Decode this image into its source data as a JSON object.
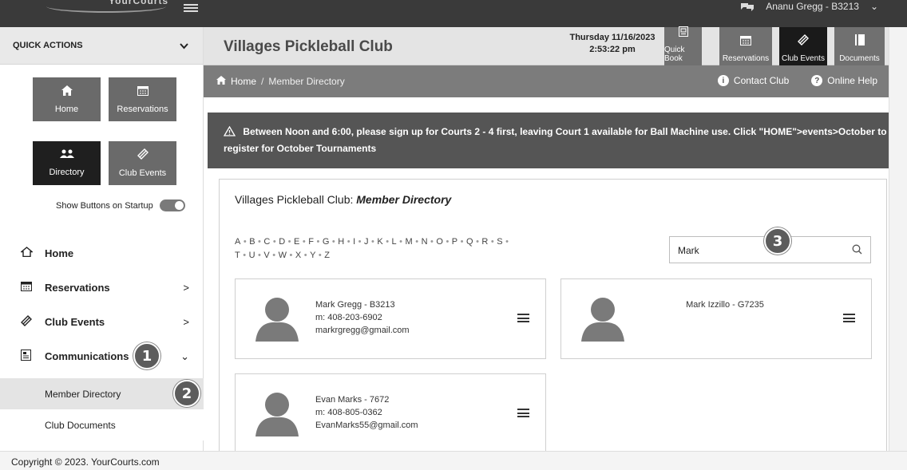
{
  "topbar": {
    "logo_text": "YourCourts",
    "user_name": "Ananu Gregg - B3213",
    "user_chevron": "⌄"
  },
  "sidebar": {
    "quick_actions_title": "QUICK ACTIONS",
    "quick_buttons": [
      {
        "label": "Home",
        "icon": "home-icon"
      },
      {
        "label": "Reservations",
        "icon": "calendar-icon"
      },
      {
        "label": "Directory",
        "icon": "people-icon"
      },
      {
        "label": "Club Events",
        "icon": "ticket-icon"
      }
    ],
    "show_buttons_label": "Show Buttons on Startup",
    "nav": [
      {
        "label": "Home",
        "icon": "home-outline-icon"
      },
      {
        "label": "Reservations",
        "icon": "calendar-icon",
        "arrow": ">"
      },
      {
        "label": "Club Events",
        "icon": "ticket-icon",
        "arrow": ">"
      },
      {
        "label": "Communications",
        "icon": "newspaper-icon",
        "arrow": "⌄"
      }
    ],
    "sub_nav": [
      {
        "label": "Member Directory"
      },
      {
        "label": "Club Documents"
      }
    ]
  },
  "header": {
    "club_name": "Villages Pickleball Club",
    "date": "Thursday 11/16/2023",
    "time": "2:53:22 pm",
    "buttons": [
      {
        "label": "Quick Book",
        "icon": "quickbook-icon"
      },
      {
        "label": "Reservations",
        "icon": "calendar-icon"
      },
      {
        "label": "Club Events",
        "icon": "ticket-icon"
      },
      {
        "label": "Documents",
        "icon": "document-icon"
      }
    ]
  },
  "breadcrumb": {
    "home": "Home",
    "separator": "/",
    "current": "Member Directory",
    "contact": "Contact Club",
    "help": "Online Help"
  },
  "alert": {
    "text": "Between Noon and 6:00, please sign up for Courts 2 - 4 first, leaving Court 1 available for Ball Machine use. Click \"HOME\">events>October to register for October Tournaments"
  },
  "directory": {
    "title_prefix": "Villages Pickleball Club: ",
    "title_emph": "Member Directory",
    "letters_row1": [
      "A",
      "B",
      "C",
      "D",
      "E",
      "F",
      "G",
      "H",
      "I",
      "J",
      "K",
      "L",
      "M",
      "N",
      "O",
      "P",
      "Q",
      "R",
      "S"
    ],
    "letters_row2": [
      "T",
      "U",
      "V",
      "W",
      "X",
      "Y",
      "Z"
    ],
    "search_value": "Mark",
    "members": [
      {
        "name": "Mark Gregg - B3213",
        "phone": "m: 408-203-6902",
        "email": "markrgregg@gmail.com"
      },
      {
        "name": "Mark Izzillo - G7235",
        "phone": "",
        "email": ""
      },
      {
        "name": "Evan Marks - 7672",
        "phone": "m: 408-805-0362",
        "email": "EvanMarks55@gmail.com"
      }
    ]
  },
  "callouts": [
    "1",
    "2",
    "3"
  ],
  "footer": {
    "copyright": "Copyright © 2023. YourCourts.com"
  }
}
